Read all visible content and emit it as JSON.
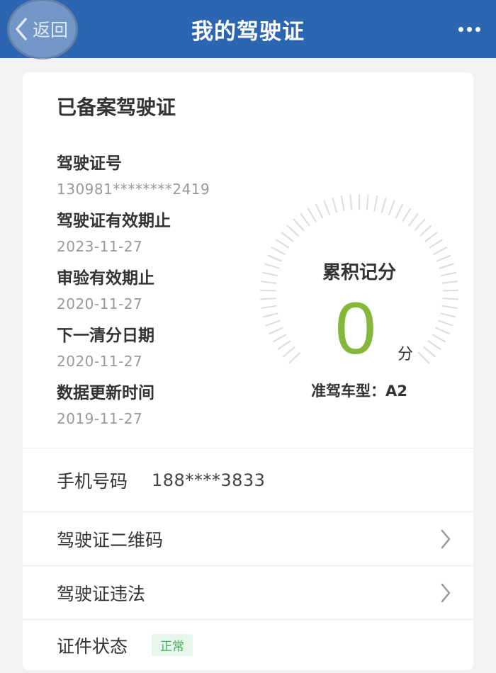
{
  "header": {
    "title": "我的驾驶证",
    "back_label": "返回"
  },
  "card": {
    "title": "已备案驾驶证",
    "fields": [
      {
        "label": "驾驶证号",
        "value": "130981********2419"
      },
      {
        "label": "驾驶证有效期止",
        "value": "2023-11-27"
      },
      {
        "label": "审验有效期止",
        "value": "2020-11-27"
      },
      {
        "label": "下一清分日期",
        "value": "2020-11-27"
      },
      {
        "label": "数据更新时间",
        "value": "2019-11-27"
      }
    ],
    "gauge": {
      "title": "累积记分",
      "points": "0",
      "unit": "分",
      "license_type": "准驾车型：A2"
    },
    "phone": {
      "label": "手机号码",
      "value": "188****3833"
    },
    "qr_code_label": "驾驶证二维码",
    "violations_label": "驾驶证违法",
    "status": {
      "label": "证件状态",
      "value": "正常"
    }
  },
  "colors": {
    "header_bg": "#2c66b1",
    "points": "#85b83a",
    "status_badge_bg": "#e6f6ea",
    "status_badge_text": "#3fae5a"
  }
}
